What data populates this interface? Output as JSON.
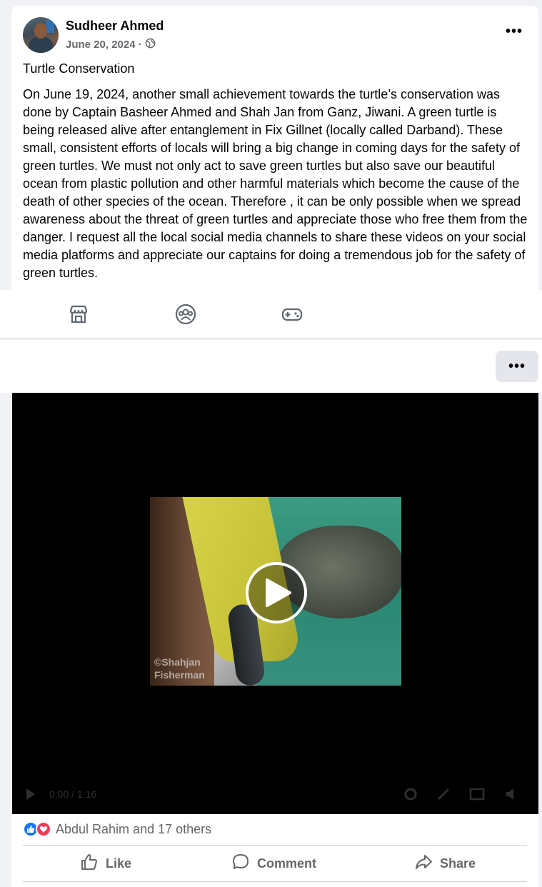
{
  "post": {
    "author": "Sudheer Ahmed",
    "date": "June 20, 2024",
    "separator": "·",
    "privacy_icon": "globe-icon",
    "more_label": "•••",
    "title": "Turtle Conservation",
    "body": "On June 19, 2024, another small achievement towards the turtle’s conservation was done by Captain Basheer Ahmed and Shah Jan from Ganz, Jiwani. A green turtle is being released alive after entanglement in Fix Gillnet (locally called Darband). These small, consistent efforts of locals will bring a big change in coming days for the safety of green turtles. We must not only act to save green turtles but also save our beautiful ocean from plastic pollution and other harmful materials which become the cause of the death of other species of the ocean. Therefore , it can be only possible when we spread awareness about the threat of green turtles and appreciate those who free them from the danger. I request all the local social media channels to share these videos on your social media platforms and appreciate our captains for doing a tremendous job for the safety of green turtles."
  },
  "icon_bar": {
    "icons": [
      "marketplace-icon",
      "groups-icon",
      "gaming-icon"
    ]
  },
  "sub_bar": {
    "more_label": "•••"
  },
  "video": {
    "watermark_line1": "©Shahjan",
    "watermark_line2": "Fisherman",
    "time": "0:00 / 1:16"
  },
  "reactions": {
    "text": "Abdul Rahim and 17 others",
    "types": [
      "like",
      "love"
    ]
  },
  "actions": {
    "like": "Like",
    "comment": "Comment",
    "share": "Share"
  },
  "colors": {
    "brand_blue": "#1877f2",
    "love_red": "#f33e58",
    "secondary_text": "#65676b"
  }
}
